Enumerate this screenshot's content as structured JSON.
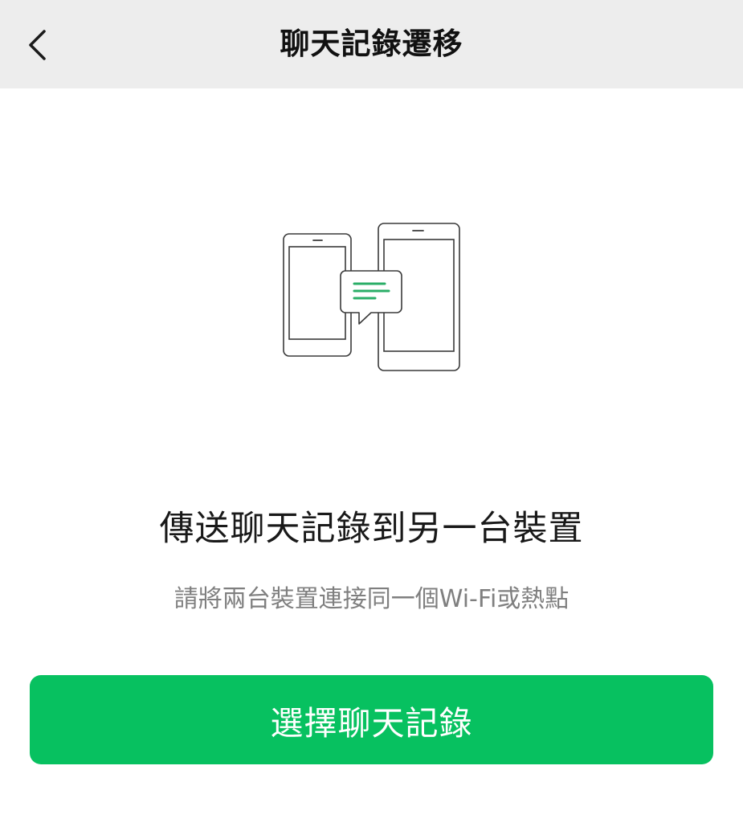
{
  "navbar": {
    "title": "聊天記錄遷移",
    "back_icon": "chevron-left-icon"
  },
  "illustration": {
    "icon": "devices-transfer-icon",
    "accent_color": "#2aae67"
  },
  "main": {
    "headline": "傳送聊天記錄到另一台裝置",
    "subline": "請將兩台裝置連接同一個Wi-Fi或熱點"
  },
  "action": {
    "label": "選擇聊天記錄",
    "color": "#07c160"
  }
}
